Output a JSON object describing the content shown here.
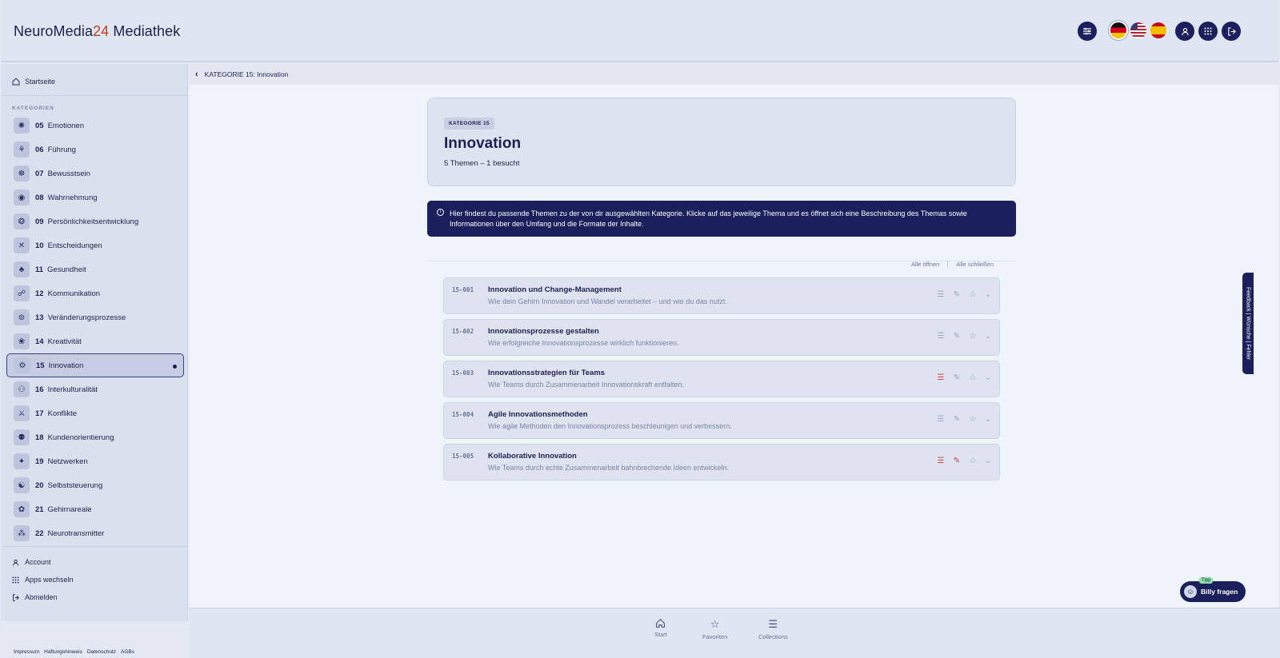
{
  "brand": {
    "part1": "NeuroMedia",
    "part2": "24",
    "part3": " Mediathek"
  },
  "header": {
    "icons": [
      "sliders-icon",
      "user-icon",
      "apps-grid-icon",
      "logout-icon"
    ],
    "languages": [
      "de",
      "us",
      "es"
    ]
  },
  "sidebar": {
    "home": "Startseite",
    "categories_label": "KATEGORIEN",
    "items": [
      {
        "num": "05",
        "label": "Emotionen"
      },
      {
        "num": "06",
        "label": "Führung"
      },
      {
        "num": "07",
        "label": "Bewusstsein"
      },
      {
        "num": "08",
        "label": "Wahrnehmung"
      },
      {
        "num": "09",
        "label": "Persönlichkeitsentwicklung"
      },
      {
        "num": "10",
        "label": "Entscheidungen"
      },
      {
        "num": "11",
        "label": "Gesundheit"
      },
      {
        "num": "12",
        "label": "Kommunikation"
      },
      {
        "num": "13",
        "label": "Veränderungsprozesse"
      },
      {
        "num": "14",
        "label": "Kreativität"
      },
      {
        "num": "15",
        "label": "Innovation"
      },
      {
        "num": "16",
        "label": "Interkulturalität"
      },
      {
        "num": "17",
        "label": "Konflikte"
      },
      {
        "num": "18",
        "label": "Kundenorientierung"
      },
      {
        "num": "19",
        "label": "Netzwerken"
      },
      {
        "num": "20",
        "label": "Selbststeuerung"
      },
      {
        "num": "21",
        "label": "Gehirnareale"
      },
      {
        "num": "22",
        "label": "Neurotransmitter"
      }
    ],
    "account": "Account",
    "apps": "Apps wechseln",
    "logout": "Abmelden"
  },
  "footer": {
    "impressum": "Impressum",
    "haftung": "Haftungshinweis",
    "datenschutz": "Datenschutz",
    "agb": "AGBs"
  },
  "breadcrumb": "KATEGORIE 15: Innovation",
  "hero": {
    "tag": "KATEGORIE 15",
    "title": "Innovation",
    "subtitle": "5 Themen – 1 besucht"
  },
  "info": "Hier findest du passende Themen zu der von dir ausgewählten Kategorie. Klicke auf das jeweilige Thema und es öffnet sich eine Beschreibung des Themas sowie Informationen über den Umfang und die Formate der Inhalte.",
  "list_actions": {
    "open_all": "Alle öffnen",
    "close_all": "Alle schließen"
  },
  "topics": [
    {
      "code": "15-001",
      "title": "Innovation und Change-Management",
      "desc": "Wie dein Gehirn Innovation und Wandel verarbeitet – und wie du das nutzt."
    },
    {
      "code": "15-002",
      "title": "Innovationsprozesse gestalten",
      "desc": "Wie erfolgreiche Innovationsprozesse wirklich funktionieren."
    },
    {
      "code": "15-003",
      "title": "Innovationsstrategien für Teams",
      "desc": "Wie Teams durch Zusammenarbeit Innovationskraft entfalten."
    },
    {
      "code": "15-004",
      "title": "Agile Innovationsmethoden",
      "desc": "Wie agile Methoden den Innovationsprozess beschleunigen und verbessern."
    },
    {
      "code": "15-005",
      "title": "Kollaborative Innovation",
      "desc": "Wie Teams durch echte Zusammenarbeit bahnbrechende Ideen entwickeln."
    }
  ],
  "feedback": "Feedback | Wünsche | Fehler",
  "billy": {
    "tipp": "Tipp",
    "label": "Billy fragen"
  },
  "bottom_nav": {
    "start": "Start",
    "favoriten": "Favoriten",
    "collections": "Collections"
  },
  "colors": {
    "primary": "#1b1f5c",
    "accent": "#b5412b",
    "alert_red": "#d13a4a"
  }
}
